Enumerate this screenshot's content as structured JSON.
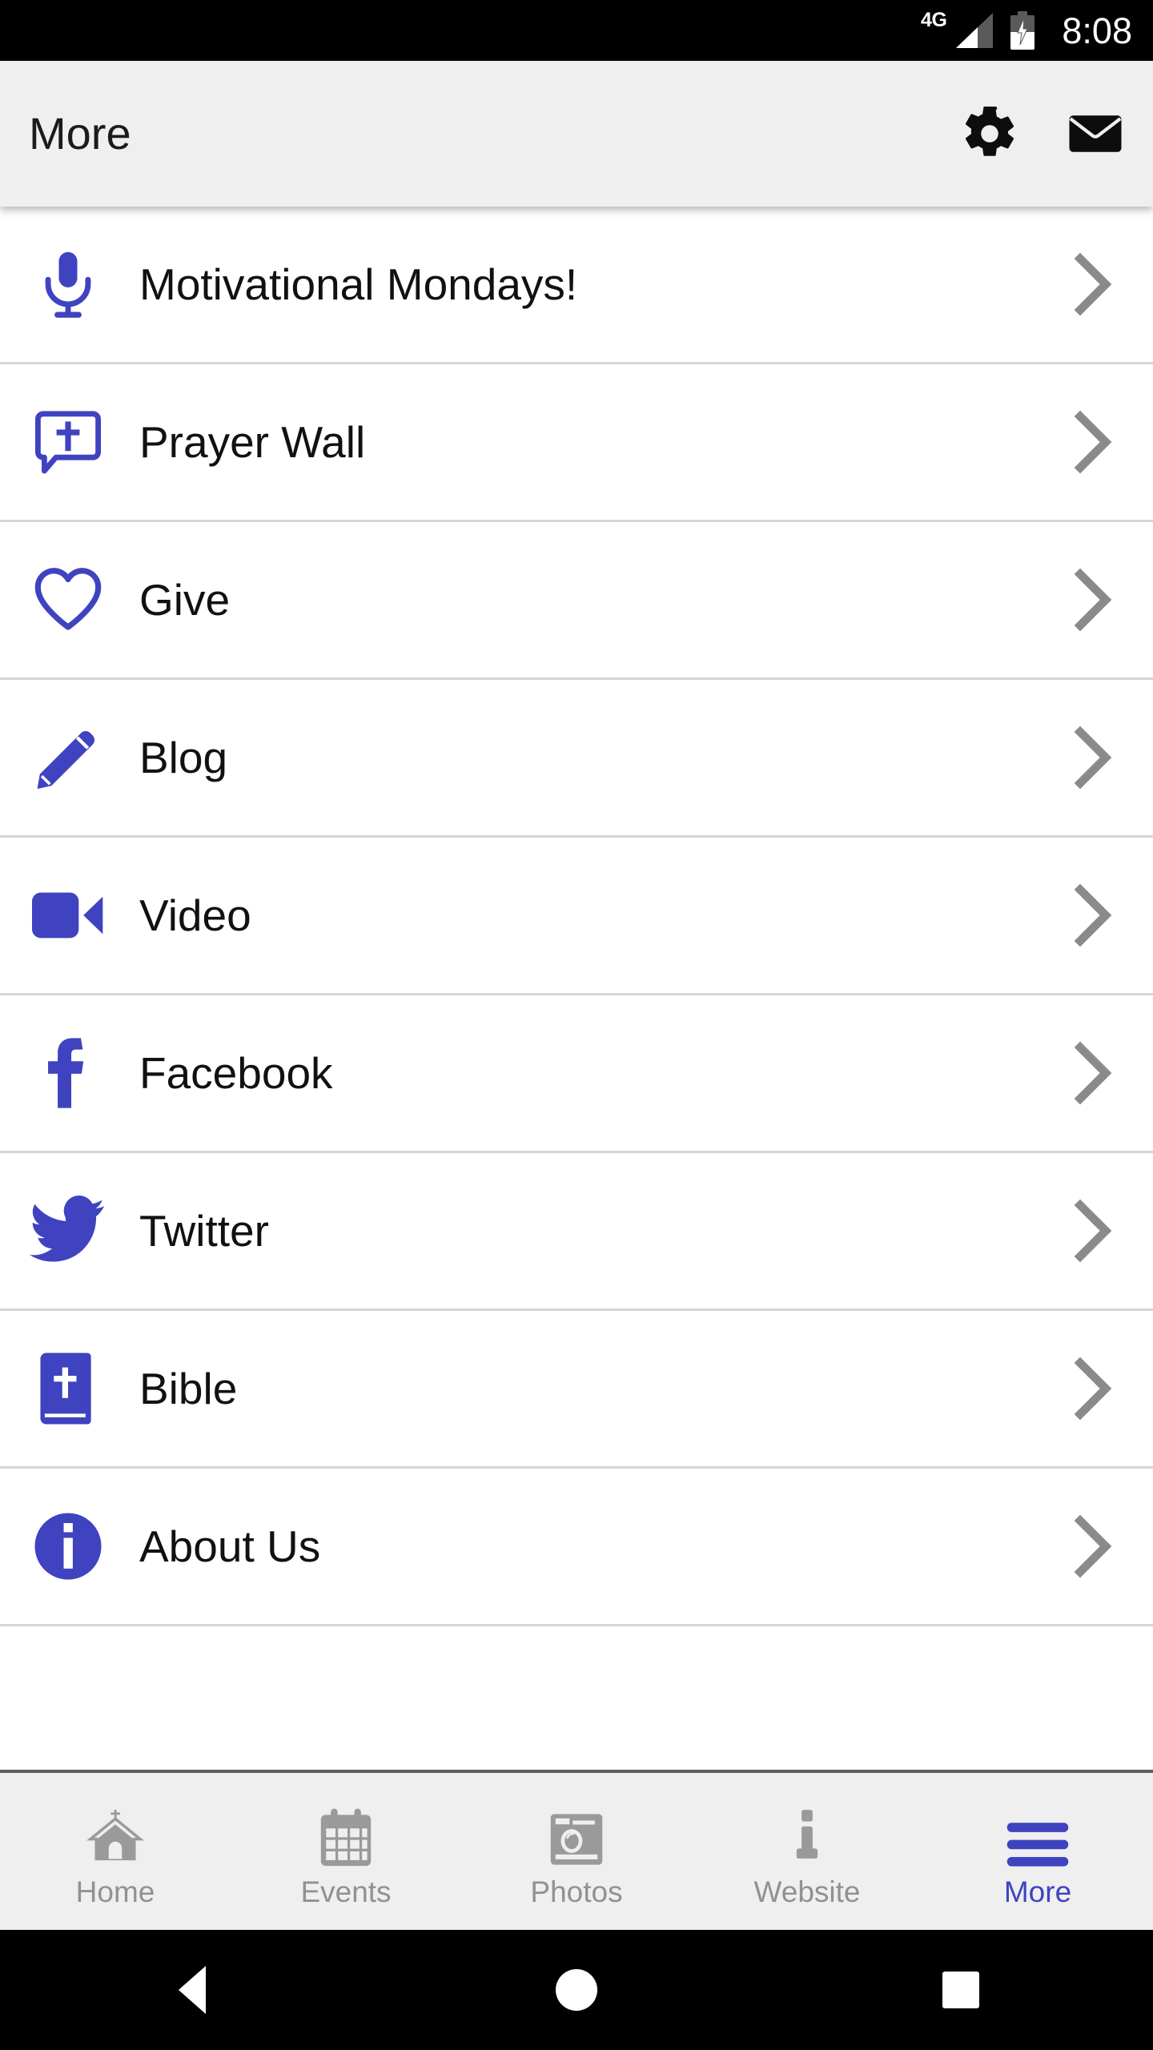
{
  "status_bar": {
    "network": "4G",
    "time": "8:08",
    "battery_icon": "battery-charging-icon",
    "signal_icon": "signal-bars-icon"
  },
  "app_bar": {
    "title": "More",
    "actions": [
      {
        "name": "settings-button",
        "icon": "gear-icon"
      },
      {
        "name": "mail-button",
        "icon": "envelope-icon"
      }
    ]
  },
  "menu": {
    "items": [
      {
        "label": "Motivational Mondays!",
        "icon": "microphone-icon"
      },
      {
        "label": "Prayer Wall",
        "icon": "speech-bubble-cross-icon"
      },
      {
        "label": "Give",
        "icon": "heart-outline-icon"
      },
      {
        "label": "Blog",
        "icon": "pencil-icon"
      },
      {
        "label": "Video",
        "icon": "video-camera-icon"
      },
      {
        "label": "Facebook",
        "icon": "facebook-icon"
      },
      {
        "label": "Twitter",
        "icon": "twitter-bird-icon"
      },
      {
        "label": "Bible",
        "icon": "bible-book-icon"
      },
      {
        "label": "About Us",
        "icon": "info-circle-icon"
      }
    ],
    "chevron_icon": "chevron-right-icon"
  },
  "tab_bar": {
    "tabs": [
      {
        "label": "Home",
        "icon": "church-icon",
        "active": false
      },
      {
        "label": "Events",
        "icon": "calendar-icon",
        "active": false
      },
      {
        "label": "Photos",
        "icon": "camera-icon",
        "active": false
      },
      {
        "label": "Website",
        "icon": "info-letter-icon",
        "active": false
      },
      {
        "label": "More",
        "icon": "hamburger-menu-icon",
        "active": true
      }
    ]
  },
  "nav_bar": {
    "back_icon": "back-triangle-icon",
    "home_icon": "home-circle-icon",
    "recents_icon": "recents-square-icon"
  },
  "colors": {
    "accent_blue": "#3f43c0",
    "chrome_gray": "#efefef",
    "divider": "#d6d6d6",
    "inactive_tab": "#919191",
    "text": "#111111"
  }
}
